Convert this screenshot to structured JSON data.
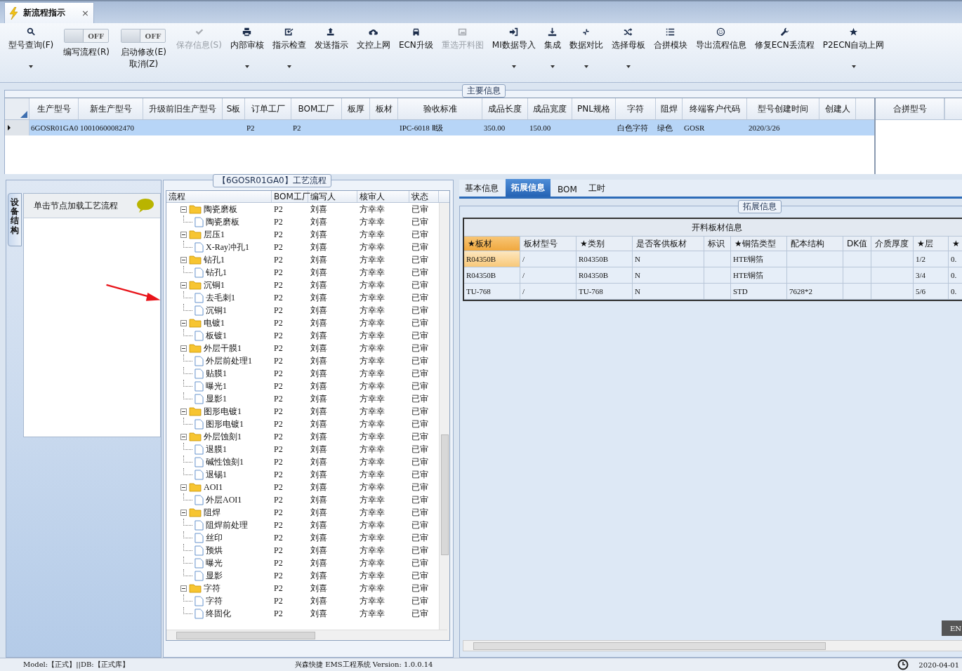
{
  "tab": {
    "title": "新流程指示",
    "close": "×"
  },
  "toolbar": [
    {
      "kind": "button",
      "label": "型号查询(F)",
      "disabled": false,
      "dropdown": true
    },
    {
      "kind": "toggle",
      "label": "编写流程(R)",
      "on": false,
      "state_text": "OFF"
    },
    {
      "kind": "toggle",
      "label": "启动修改(E)",
      "label_2": "取消(Z)",
      "on": false,
      "state_text": "OFF"
    },
    {
      "kind": "button",
      "label": "保存信息(S)",
      "disabled": true,
      "dropdown": false
    },
    {
      "kind": "button",
      "label": "内部审核",
      "disabled": false,
      "dropdown": true
    },
    {
      "kind": "button",
      "label": "指示检查",
      "disabled": false,
      "dropdown": true
    },
    {
      "kind": "button",
      "label": "发送指示",
      "disabled": false,
      "dropdown": false
    },
    {
      "kind": "button",
      "label": "文控上网",
      "disabled": false,
      "dropdown": false
    },
    {
      "kind": "button",
      "label": "ECN升级",
      "disabled": false,
      "dropdown": false
    },
    {
      "kind": "button",
      "label": "重选开料图",
      "disabled": true,
      "dropdown": false
    },
    {
      "kind": "button",
      "label": "MI数据导入",
      "disabled": false,
      "dropdown": true
    },
    {
      "kind": "button",
      "label": "集成",
      "disabled": false,
      "dropdown": true
    },
    {
      "kind": "button",
      "label": "数据对比",
      "disabled": false,
      "dropdown": true
    },
    {
      "kind": "button",
      "label": "选择母板",
      "disabled": false,
      "dropdown": true
    },
    {
      "kind": "button",
      "label": "合拼模块",
      "disabled": false,
      "dropdown": false
    },
    {
      "kind": "button",
      "label": "导出流程信息",
      "disabled": false,
      "dropdown": false
    },
    {
      "kind": "button",
      "label": "修复ECN丢流程",
      "disabled": false,
      "dropdown": false
    },
    {
      "kind": "button",
      "label": "P2ECN自动上网",
      "disabled": false,
      "dropdown": true
    }
  ],
  "main_info": {
    "legend": "主要信息",
    "columns": [
      "生产型号",
      "新生产型号",
      "升级前旧生产型号",
      "S板",
      "订单工厂",
      "BOM工厂",
      "板厚",
      "板材",
      "验收标准",
      "成品长度",
      "成品宽度",
      "PNL规格",
      "字符",
      "阻焊",
      "终端客户代码",
      "型号创建时间",
      "创建人"
    ],
    "rows": [
      {
        "selected": true,
        "cells": [
          "6GOSR01GA0",
          "10010600082470",
          "",
          "",
          "P2",
          "P2",
          "",
          "",
          "IPC-6018 Ⅱ级",
          "350.00",
          "150.00",
          "",
          "白色字符",
          "绿色",
          "GOSR",
          "2020/3/26",
          ""
        ]
      }
    ],
    "merge_panel": {
      "columns": [
        "合拼型号"
      ]
    }
  },
  "left_panel": {
    "side_tab": "设备结构",
    "header": "单击节点加载工艺流程"
  },
  "process": {
    "legend": "【6GOSR01GA0】工艺流程",
    "columns": [
      "流程",
      "BOM工厂",
      "编写人",
      "核审人",
      "状态"
    ],
    "tree": [
      {
        "name": "陶瓷磨板",
        "expanded": true,
        "bom": "P2",
        "writer": "刘喜",
        "reviewer": "方幸幸",
        "status": "已审",
        "children": [
          {
            "name": "陶瓷磨板",
            "bom": "P2",
            "writer": "刘喜",
            "reviewer": "方幸幸",
            "status": "已审"
          }
        ]
      },
      {
        "name": "层压1",
        "expanded": true,
        "bom": "P2",
        "writer": "刘喜",
        "reviewer": "方幸幸",
        "status": "已审",
        "children": [
          {
            "name": "X-Ray冲孔1",
            "bom": "P2",
            "writer": "刘喜",
            "reviewer": "方幸幸",
            "status": "已审"
          }
        ]
      },
      {
        "name": "钻孔1",
        "expanded": true,
        "bom": "P2",
        "writer": "刘喜",
        "reviewer": "方幸幸",
        "status": "已审",
        "children": [
          {
            "name": "钻孔1",
            "bom": "P2",
            "writer": "刘喜",
            "reviewer": "方幸幸",
            "status": "已审"
          }
        ]
      },
      {
        "name": "沉铜1",
        "expanded": true,
        "bom": "P2",
        "writer": "刘喜",
        "reviewer": "方幸幸",
        "status": "已审",
        "children": [
          {
            "name": "去毛刺1",
            "bom": "P2",
            "writer": "刘喜",
            "reviewer": "方幸幸",
            "status": "已审"
          },
          {
            "name": "沉铜1",
            "bom": "P2",
            "writer": "刘喜",
            "reviewer": "方幸幸",
            "status": "已审"
          }
        ]
      },
      {
        "name": "电镀1",
        "expanded": true,
        "bom": "P2",
        "writer": "刘喜",
        "reviewer": "方幸幸",
        "status": "已审",
        "children": [
          {
            "name": "板镀1",
            "bom": "P2",
            "writer": "刘喜",
            "reviewer": "方幸幸",
            "status": "已审"
          }
        ]
      },
      {
        "name": "外层干膜1",
        "expanded": true,
        "bom": "P2",
        "writer": "刘喜",
        "reviewer": "方幸幸",
        "status": "已审",
        "children": [
          {
            "name": "外层前处理1",
            "bom": "P2",
            "writer": "刘喜",
            "reviewer": "方幸幸",
            "status": "已审"
          },
          {
            "name": "贴膜1",
            "bom": "P2",
            "writer": "刘喜",
            "reviewer": "方幸幸",
            "status": "已审"
          },
          {
            "name": "曝光1",
            "bom": "P2",
            "writer": "刘喜",
            "reviewer": "方幸幸",
            "status": "已审"
          },
          {
            "name": "显影1",
            "bom": "P2",
            "writer": "刘喜",
            "reviewer": "方幸幸",
            "status": "已审"
          }
        ]
      },
      {
        "name": "图形电镀1",
        "expanded": true,
        "bom": "P2",
        "writer": "刘喜",
        "reviewer": "方幸幸",
        "status": "已审",
        "children": [
          {
            "name": "图形电镀1",
            "bom": "P2",
            "writer": "刘喜",
            "reviewer": "方幸幸",
            "status": "已审"
          }
        ]
      },
      {
        "name": "外层蚀刻1",
        "expanded": true,
        "bom": "P2",
        "writer": "刘喜",
        "reviewer": "方幸幸",
        "status": "已审",
        "children": [
          {
            "name": "退膜1",
            "bom": "P2",
            "writer": "刘喜",
            "reviewer": "方幸幸",
            "status": "已审"
          },
          {
            "name": "碱性蚀刻1",
            "bom": "P2",
            "writer": "刘喜",
            "reviewer": "方幸幸",
            "status": "已审"
          },
          {
            "name": "退锡1",
            "bom": "P2",
            "writer": "刘喜",
            "reviewer": "方幸幸",
            "status": "已审"
          }
        ]
      },
      {
        "name": "AOI1",
        "expanded": true,
        "bom": "P2",
        "writer": "刘喜",
        "reviewer": "方幸幸",
        "status": "已审",
        "children": [
          {
            "name": "外层AOI1",
            "bom": "P2",
            "writer": "刘喜",
            "reviewer": "方幸幸",
            "status": "已审"
          }
        ]
      },
      {
        "name": "阻焊",
        "expanded": true,
        "bom": "P2",
        "writer": "刘喜",
        "reviewer": "方幸幸",
        "status": "已审",
        "children": [
          {
            "name": "阻焊前处理",
            "bom": "P2",
            "writer": "刘喜",
            "reviewer": "方幸幸",
            "status": "已审"
          },
          {
            "name": "丝印",
            "bom": "P2",
            "writer": "刘喜",
            "reviewer": "方幸幸",
            "status": "已审"
          },
          {
            "name": "预烘",
            "bom": "P2",
            "writer": "刘喜",
            "reviewer": "方幸幸",
            "status": "已审"
          },
          {
            "name": "曝光",
            "bom": "P2",
            "writer": "刘喜",
            "reviewer": "方幸幸",
            "status": "已审"
          },
          {
            "name": "显影",
            "bom": "P2",
            "writer": "刘喜",
            "reviewer": "方幸幸",
            "status": "已审"
          }
        ]
      },
      {
        "name": "字符",
        "expanded": true,
        "bom": "P2",
        "writer": "刘喜",
        "reviewer": "方幸幸",
        "status": "已审",
        "children": [
          {
            "name": "字符",
            "bom": "P2",
            "writer": "刘喜",
            "reviewer": "方幸幸",
            "status": "已审"
          },
          {
            "name": "终固化",
            "bom": "P2",
            "writer": "刘喜",
            "reviewer": "方幸幸",
            "status": "已审"
          }
        ]
      }
    ]
  },
  "detail_tabs": [
    {
      "label": "基本信息",
      "selected": false
    },
    {
      "label": "拓展信息",
      "selected": true
    },
    {
      "label": "BOM",
      "selected": false
    },
    {
      "label": "工时",
      "selected": false
    }
  ],
  "extended": {
    "legend": "拓展信息",
    "caption": "开料板材信息",
    "columns": [
      "★板材",
      "板材型号",
      "★类别",
      "是否客供板材",
      "标识",
      "★铜箔类型",
      "配本结构",
      "DK值",
      "介质厚度",
      "★层",
      "★"
    ],
    "rows": [
      {
        "selected": true,
        "cells": [
          "R04350B",
          "/",
          "R04350B",
          "N",
          "",
          "HTE铜箔",
          "",
          "",
          "",
          "1/2",
          "0."
        ]
      },
      {
        "selected": false,
        "cells": [
          "R04350B",
          "/",
          "R04350B",
          "N",
          "",
          "HTE铜箔",
          "",
          "",
          "",
          "3/4",
          "0."
        ]
      },
      {
        "selected": false,
        "cells": [
          "TU-768",
          "/",
          "TU-768",
          "N",
          "",
          "STD",
          "7628*2",
          "",
          "",
          "5/6",
          "0."
        ]
      }
    ]
  },
  "language_button": "EN",
  "status_bar": {
    "model": "Model:【正式】||DB:【正式库】",
    "system": "兴森快捷 EMS工程系统 Version: 1.0.0.14",
    "date": "2020-04-01"
  }
}
